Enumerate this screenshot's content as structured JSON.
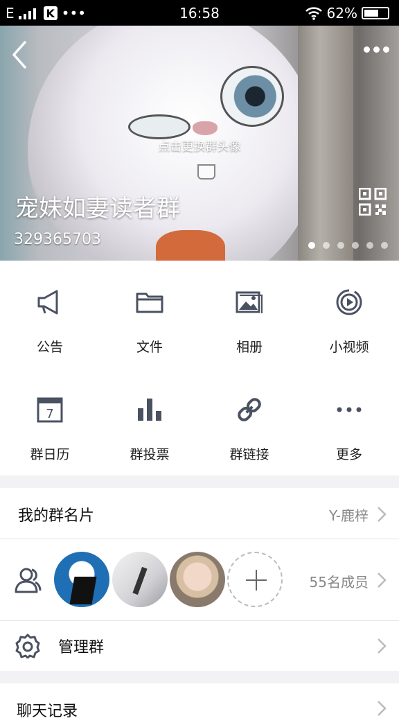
{
  "status_bar": {
    "network": "E",
    "app_badge": "K",
    "notification_dots": "•••",
    "time": "16:58",
    "battery_percent": "62%",
    "battery_level": 0.62
  },
  "header": {
    "change_avatar_text": "点击更换群头像",
    "group_name": "宠妹如妻读者群",
    "group_id": "329365703",
    "carousel_total": 6,
    "carousel_active": 1
  },
  "actions": [
    {
      "label": "公告",
      "icon": "megaphone-icon"
    },
    {
      "label": "文件",
      "icon": "folder-icon"
    },
    {
      "label": "相册",
      "icon": "album-icon"
    },
    {
      "label": "小视频",
      "icon": "video-icon"
    },
    {
      "label": "群日历",
      "icon": "calendar-icon"
    },
    {
      "label": "群投票",
      "icon": "bar-chart-icon"
    },
    {
      "label": "群链接",
      "icon": "link-icon"
    },
    {
      "label": "更多",
      "icon": "more-icon"
    }
  ],
  "calendar_day": "7",
  "card": {
    "label": "我的群名片",
    "value": "Y-鹿梓"
  },
  "members": {
    "count_text": "55名成员"
  },
  "manage": {
    "label": "管理群"
  },
  "chat": {
    "label": "聊天记录"
  },
  "colors": {
    "icon": "#4a5161",
    "separator": "#f2f2f4"
  }
}
